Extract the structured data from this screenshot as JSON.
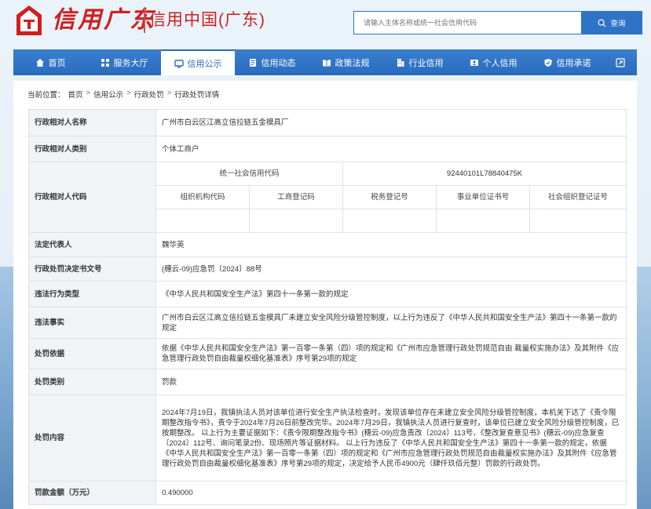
{
  "header": {
    "logo_script": "信用广东",
    "site_name": "信用中国(广东)",
    "search_placeholder": "请输入主体名称或统一社会信用代码",
    "search_button": "查询"
  },
  "nav": {
    "items": [
      {
        "label": "首页",
        "icon": "home-icon"
      },
      {
        "label": "服务大厅",
        "icon": "grid-icon"
      },
      {
        "label": "信用公示",
        "icon": "monitor-icon",
        "active": true
      },
      {
        "label": "信用动态",
        "icon": "document-icon"
      },
      {
        "label": "政策法规",
        "icon": "book-icon"
      },
      {
        "label": "行业信用",
        "icon": "building-icon"
      },
      {
        "label": "个人信用",
        "icon": "id-card-icon"
      },
      {
        "label": "信用承诺",
        "icon": "shield-icon"
      }
    ],
    "expand_icon": "expand-icon"
  },
  "breadcrumb": {
    "prefix": "当前位置：",
    "items": [
      "首页",
      "信用公示",
      "行政处罚",
      "行政处罚详情"
    ],
    "separator": ">"
  },
  "detail": {
    "party_name_label": "行政相对人名称",
    "party_name": "广州市白云区江高立信拉链五金模具厂",
    "party_type_label": "行政相对人类别",
    "party_type": "个体工商户",
    "party_code_label": "行政相对人代码",
    "uscc_label": "统一社会信用代码",
    "uscc_value": "92440101L78840475K",
    "org_code_label": "组织机构代码",
    "biz_reg_label": "工商登记码",
    "tax_reg_label": "税务登记号",
    "inst_cert_label": "事业单位证书号",
    "social_org_label": "社会组织登记证号",
    "legal_rep_label": "法定代表人",
    "legal_rep": "魏华英",
    "decision_no_label": "行政处罚决定书文号",
    "decision_no": "(穗云-09)应急罚〔2024〕88号",
    "violation_type_label": "违法行为类型",
    "violation_type": "《中华人民共和国安全生产法》第四十一条第一款的规定",
    "facts_label": "违法事实",
    "facts": "广州市白云区江高立信拉链五金模具厂未建立安全风险分级管控制度，以上行为违反了《中华人民共和国安全生产法》第四十一条第一款的规定",
    "basis_label": "处罚依据",
    "basis": "依据《中华人民共和国安全生产法》第一百零一条第（四）项的规定和《广州市应急管理行政处罚规范自由 裁量权实施办法》及其附件《应急管理行政处罚自由裁量权细化基准表》序号第29项的规定",
    "penalty_type_label": "处罚类别",
    "penalty_type": "罚款",
    "penalty_content_label": "处罚内容",
    "penalty_content": "2024年7月19日，我镇执法人员对该单位进行安全生产执法检查时，发现该单位存在未建立安全风险分级管控制度，本机关下达了《责令限期整改指令书》，责令于2024年7月26日前整改完毕。2024年7月29日，我镇执法人员进行复查时，该单位已建立安全风险分级管控制度，已按期整改。 以上行为主要证据如下：《责令限期整改指令书》(穗云-09)应急责改〔2024〕113号、《整改复查意见书》(穗云-09)应急复查〔2024〕112号、询问笔录2份、现场照片等证据材料。 以上行为违反了《中华人民共和国安全生产法》第四十一条第一款的规定，依据《中华人民共和国安全生产法》第一百零一条第（四）项的规定和《广州市应急管理行政处罚规范自由裁量权实施办法》及其附件《应急管理行政处罚自由裁量权细化基准表》序号第29项的规定，决定给予人民币4900元（肆仟玖佰元整）罚款的行政处罚。",
    "fine_label": "罚款金额（万元）",
    "fine": "0.490000"
  },
  "colors": {
    "brand_red": "#cf1f1f",
    "nav_blue": "#2a6bbd",
    "label_bg": "#f1f3f6"
  }
}
